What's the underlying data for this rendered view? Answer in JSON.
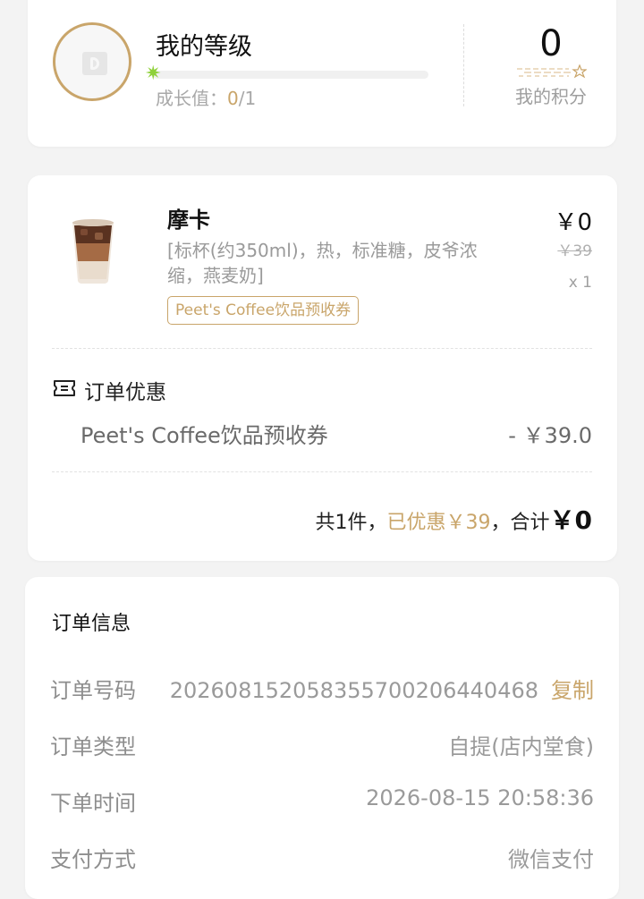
{
  "level": {
    "title": "我的等级",
    "growth_label": "成长值：",
    "growth_current": "0",
    "growth_total": "/1",
    "progress": 0,
    "points_value": "0",
    "points_label": "我的积分"
  },
  "product": {
    "name": "摩卡",
    "spec": "[标杯(约350ml)，热，标准糖，皮爷浓缩，燕麦奶]",
    "coupon_tag": "Peet's Coffee饮品预收券",
    "price": "￥0",
    "original_price": "￥39",
    "quantity": "x 1"
  },
  "promotion": {
    "title": "订单优惠",
    "coupon_name": "Peet's Coffee饮品预收券",
    "amount": "- ￥39.0"
  },
  "summary": {
    "count_text": "共1件，",
    "discount_text": "已优惠￥39",
    "total_label": "，合计",
    "total_value": "￥0"
  },
  "order_info": {
    "title": "订单信息",
    "rows": [
      {
        "label": "订单号码",
        "value": "202608152058355700206440468",
        "action": "复制"
      },
      {
        "label": "订单类型",
        "value": "自提(店内堂食)"
      },
      {
        "label": "下单时间",
        "value": "2026-08-15 20:58:36"
      },
      {
        "label": "支付方式",
        "value": "微信支付"
      }
    ]
  },
  "colors": {
    "accent_gold": "#c9a56a",
    "progress_star": "#8fd13a"
  },
  "icons": {
    "progress_marker": "sparkle-icon",
    "avatar": "brand-logo-icon",
    "promotion": "ticket-icon"
  }
}
